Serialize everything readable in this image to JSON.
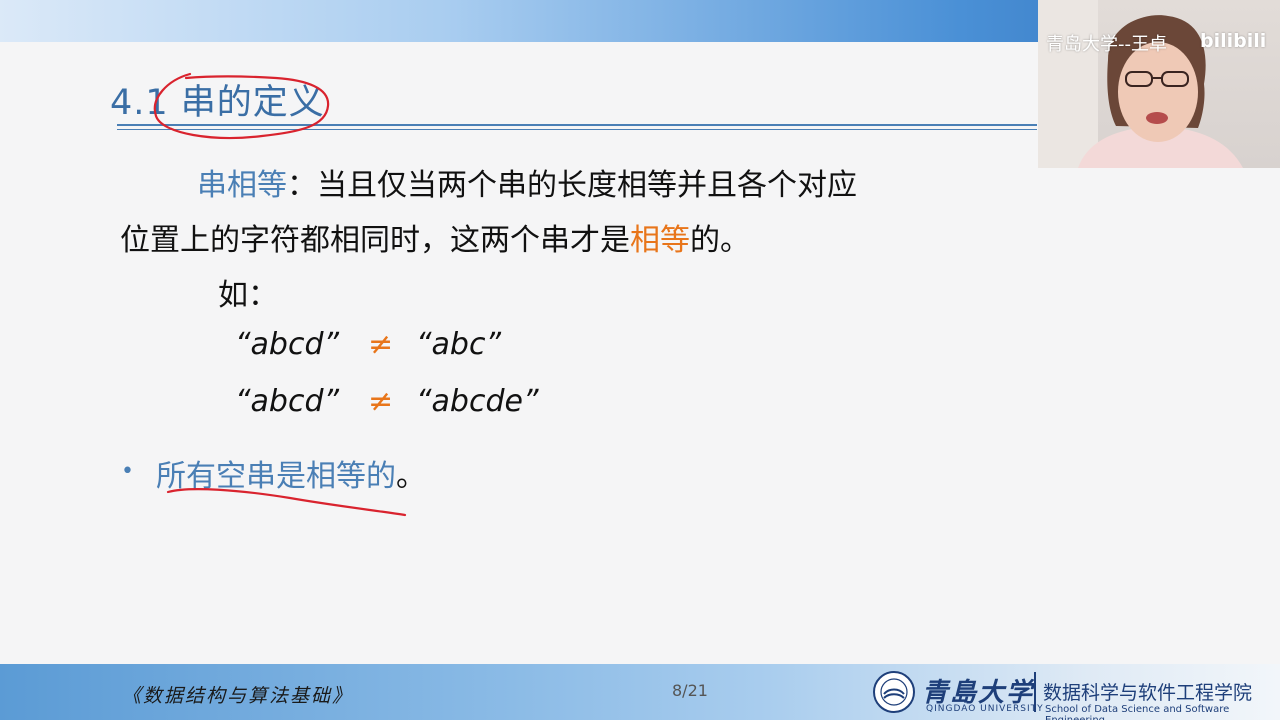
{
  "slide": {
    "title": "4.1 串的定义",
    "para1_term": "串相等",
    "para1_rest": "：当且仅当两个串的长度相等并且各个对应",
    "para2_start": "位置上的字符都相同时，这两个串才是",
    "para2_highlight": "相等",
    "para2_end": "的。",
    "example_intro": "如：",
    "examples": [
      {
        "left": "“abcd”",
        "op": "≠",
        "right": "“abc”"
      },
      {
        "left": "“abcd”",
        "op": "≠",
        "right": "“abcde”"
      }
    ],
    "bullet_text": "所有空串是相等的",
    "bullet_end": "。"
  },
  "webcam": {
    "caption": "青岛大学--王卓",
    "logo": "bilibili"
  },
  "footer": {
    "book": "《数据结构与算法基础》",
    "page": "8/21",
    "university": "青島大学",
    "university_en": "QINGDAO UNIVERSITY",
    "school": "数据科学与软件工程学院",
    "school_en": "School of Data Science and Software Engineering"
  },
  "colors": {
    "accent_blue": "#4a7fb5",
    "highlight_orange": "#e8751a",
    "annotation_red": "#d9232e"
  }
}
